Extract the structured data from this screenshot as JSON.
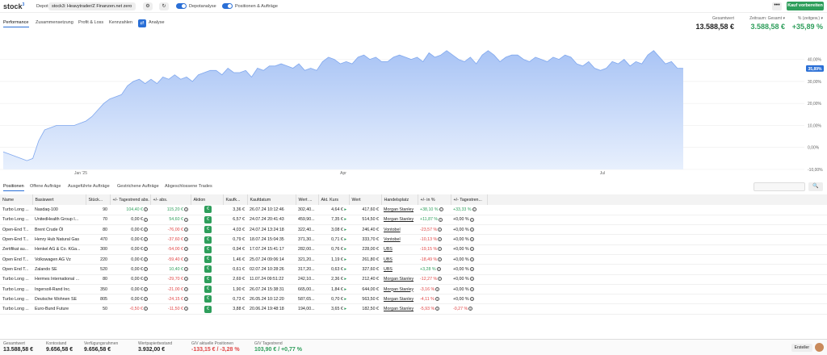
{
  "topbar": {
    "logo": "stock",
    "logo_sup": "3",
    "depot_label": "Depot",
    "depot_value": "stock3: Heavytrader/Z Finanzen.net zero",
    "toggle1_label": "Depotanalyse",
    "toggle2_label": "Positionen & Aufträge",
    "more_label": "•••",
    "buy_label": "Kauf vorbereiten"
  },
  "tabs": [
    {
      "label": "Performance"
    },
    {
      "label": "Zusammensetzung"
    },
    {
      "label": "Profit & Loss"
    },
    {
      "label": "Kennzahlen"
    },
    {
      "label": "Analyse"
    }
  ],
  "kpis": {
    "gesamtwert_label": "Gesamtwert",
    "gesamtwert": "13.588,58 €",
    "zeitraum_label": "Zeitraum: Gesamt ▾",
    "zeitraum_value": "3.588,58 €",
    "prozent_label": "% (zeitgew.) ▾",
    "prozent_value": "+35,89 %"
  },
  "chart_data": {
    "type": "area",
    "x_ticks": [
      "Jan '25",
      "Apr",
      "Jul"
    ],
    "y_ticks": [
      "40,00%",
      "30,00%",
      "20,00%",
      "10,00%",
      "0,00%",
      "-10,00%"
    ],
    "ylim": [
      -10,
      45
    ],
    "current_label": "35,89%",
    "values": [
      -2,
      -3,
      -4,
      -5,
      -6,
      -5,
      3,
      8,
      9,
      10,
      10,
      10,
      10,
      11,
      12,
      14,
      17,
      20,
      22,
      23,
      24,
      28,
      30,
      31,
      29,
      31,
      29,
      32,
      31,
      33,
      31,
      32,
      30,
      33,
      34,
      35,
      35,
      33,
      36,
      34,
      34,
      35,
      32,
      36,
      35,
      37,
      37,
      38,
      37,
      36,
      38,
      35,
      36,
      35,
      39,
      41,
      40,
      38,
      39,
      38,
      41,
      42,
      40,
      41,
      39,
      39,
      41,
      42,
      41,
      40,
      41,
      39,
      43,
      41,
      42,
      44,
      42,
      40,
      39,
      41,
      38,
      42,
      44,
      42,
      39,
      41,
      42,
      42,
      40,
      39,
      41,
      40,
      39,
      41,
      40,
      42,
      41,
      38,
      37,
      39,
      36,
      35,
      36,
      39,
      38,
      40,
      37,
      39,
      38,
      42,
      44,
      41,
      38,
      39,
      36,
      35.89
    ]
  },
  "subtabs": [
    {
      "label": "Positionen"
    },
    {
      "label": "Offene Aufträge"
    },
    {
      "label": "Ausgeführte Aufträge"
    },
    {
      "label": "Gestrichene Aufträge"
    },
    {
      "label": "Abgeschlossene Trades"
    }
  ],
  "table": {
    "headers": [
      "Name",
      "Basiswert",
      "Stück...",
      "+/- Tagestrend abs.",
      "+/- abs.",
      "Aktion",
      "Kaufk...",
      "Kaufdatum",
      "Wert ...",
      "Akt. Kurs",
      "Wert",
      "Handelsplatz",
      "+/- in %",
      "+/- Tagestren..."
    ],
    "rows": [
      [
        "Turbo Long ...",
        "Nasdaq-100",
        "90",
        "104,40 €",
        "115,20 €",
        "€",
        "3,36 €",
        "26.07.24 10:12:46",
        "302,40...",
        "4,64 €",
        "417,60 €",
        "Morgan Stanley",
        "+38,10 %",
        "+33,33 %"
      ],
      [
        "Turbo Long ...",
        "UnitedHealth Group I...",
        "70",
        "0,00 €",
        "54,60 €",
        "€",
        "6,57 €",
        "24.07.24 20:41:43",
        "459,90...",
        "7,35 €",
        "514,50 €",
        "Morgan Stanley",
        "+11,87 %",
        "+0,00 %"
      ],
      [
        "Open-End T...",
        "Brent Crude Öl",
        "80",
        "0,00 €",
        "-76,00 €",
        "€",
        "4,03 €",
        "24.07.24 13:24:18",
        "322,40...",
        "3,08 €",
        "246,40 €",
        "Vontobel",
        "-23,57 %",
        "+0,00 %"
      ],
      [
        "Open-End T...",
        "Henry Hub Natural Gas",
        "470",
        "0,00 €",
        "-37,60 €",
        "€",
        "0,79 €",
        "18.07.24 15:04:35",
        "371,30...",
        "0,71 €",
        "333,70 €",
        "Vontobel",
        "-10,13 %",
        "+0,00 %"
      ],
      [
        "Zertifikat au...",
        "Henkel AG & Co. KGa...",
        "300",
        "0,00 €",
        "-54,00 €",
        "€",
        "0,94 €",
        "17.07.24 15:41:17",
        "282,00...",
        "0,76 €",
        "228,00 €",
        "UBS",
        "-19,15 %",
        "+0,00 %"
      ],
      [
        "Open End T...",
        "Volkswagen AG Vz",
        "220",
        "0,00 €",
        "-59,40 €",
        "€",
        "1,46 €",
        "25.07.24 09:06:14",
        "321,20...",
        "1,19 €",
        "261,80 €",
        "UBS",
        "-18,49 %",
        "+0,00 %"
      ],
      [
        "Open End T...",
        "Zalando SE",
        "520",
        "0,00 €",
        "10,40 €",
        "€",
        "0,61 €",
        "02.07.24 10:28:26",
        "317,20...",
        "0,63 €",
        "327,60 €",
        "UBS",
        "+3,28 %",
        "+0,00 %"
      ],
      [
        "Turbo Long ...",
        "Hermes International ...",
        "80",
        "0,00 €",
        "-29,70 €",
        "€",
        "2,69 €",
        "11.07.24 09:51:22",
        "242,10...",
        "2,36 €",
        "212,40 €",
        "Morgan Stanley",
        "-12,27 %",
        "+0,00 %"
      ],
      [
        "Turbo Long ...",
        "Ingersoll-Rand Inc.",
        "350",
        "0,00 €",
        "-21,00 €",
        "€",
        "1,90 €",
        "26.07.24 15:38:31",
        "665,00...",
        "1,84 €",
        "644,00 €",
        "Morgan Stanley",
        "-3,16 %",
        "+0,00 %"
      ],
      [
        "Turbo Long ...",
        "Deutsche Wohnen SE",
        "805",
        "0,00 €",
        "-24,15 €",
        "€",
        "0,73 €",
        "26.05.24 10:12:20",
        "587,65...",
        "0,70 €",
        "563,50 €",
        "Morgan Stanley",
        "-4,11 %",
        "+0,00 %"
      ],
      [
        "Turbo Long ...",
        "Euro-Bund Future",
        "50",
        "-0,50 €",
        "-11,50 €",
        "€",
        "3,88 €",
        "20.06.24 19:48:18",
        "194,00...",
        "3,65 €",
        "182,50 €",
        "Morgan Stanley",
        "-5,93 %",
        "-0,27 %"
      ]
    ]
  },
  "footer": {
    "gesamtwert_label": "Gesamtwert",
    "gesamtwert": "13.588,58 €",
    "kontostand_label": "Kontostand",
    "kontostand": "9.656,58 €",
    "verfuegung_label": "Verfügungsrahmen",
    "verfuegung": "9.656,58 €",
    "wertpapier_label": "Wertpapierbestand",
    "wertpapier": "3.932,00 €",
    "gv_pos_label": "G/V aktuelle Positionen",
    "gv_pos": "-133,15 € / -3,28 %",
    "gv_tag_label": "G/V Tagestrend",
    "gv_tag": "103,90 € / +0,77 %",
    "ersteller": "Ersteller"
  },
  "colors": {
    "accent": "#2a6fd6",
    "green": "#2e9e5b",
    "red": "#e04646",
    "area": "#a9c4f5"
  }
}
